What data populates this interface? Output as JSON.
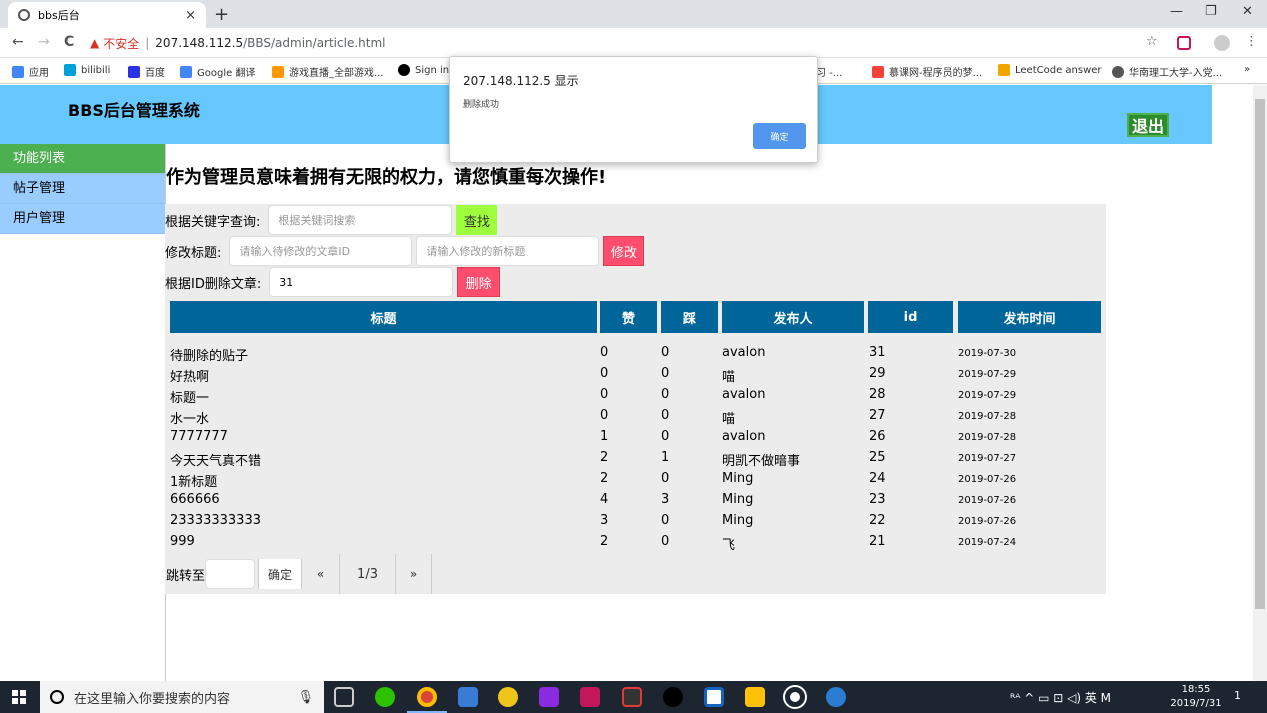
{
  "browser": {
    "tab_title": "bbs后台",
    "tab_close": "×",
    "new_tab": "+",
    "min": "—",
    "max": "❐",
    "close": "✕",
    "back": "←",
    "forward": "→",
    "reload": "C",
    "insecure_label": "不安全",
    "separator": "|",
    "url_host": "207.148.112.5",
    "url_path": "/BBS/admin/article.html",
    "star": "☆",
    "menu": "⋮",
    "bookmarks_more": "»",
    "bookmarks": [
      {
        "label": "应用",
        "icon": "apps-icon",
        "color": "#4285f4"
      },
      {
        "label": "bilibili",
        "icon": "bilibili-icon",
        "color": "#00a1d6"
      },
      {
        "label": "百度",
        "icon": "baidu-icon",
        "color": "#2932e1"
      },
      {
        "label": "Google 翻译",
        "icon": "google-translate-icon",
        "color": "#4285f4"
      },
      {
        "label": "游戏直播_全部游戏...",
        "icon": "game-icon",
        "color": "#ff9800"
      },
      {
        "label": "Sign in",
        "icon": "github-icon",
        "color": "#000000"
      },
      {
        "label": "学习 -...",
        "icon": "study-icon",
        "color": "#777777"
      },
      {
        "label": "慕课网-程序员的梦...",
        "icon": "imooc-icon",
        "color": "#f44336"
      },
      {
        "label": "LeetCode answer",
        "icon": "leetcode-icon",
        "color": "#f0a500"
      },
      {
        "label": "华南理工大学-入党...",
        "icon": "globe-icon",
        "color": "#555555"
      }
    ]
  },
  "dialog": {
    "title": "207.148.112.5 显示",
    "message": "删除成功",
    "ok": "确定"
  },
  "header": {
    "title": "BBS后台管理系统",
    "logout": "退出"
  },
  "sidebar": {
    "items": [
      {
        "label": "功能列表"
      },
      {
        "label": "帖子管理"
      },
      {
        "label": "用户管理"
      }
    ]
  },
  "main": {
    "warning_title": "作为管理员意味着拥有无限的权力，请您慎重每次操作!",
    "search_label": "根据关键字查询:",
    "search_placeholder": "根据关键词搜索",
    "search_button": "查找",
    "edit_label": "修改标题:",
    "edit_id_placeholder": "请输入待修改的文章ID",
    "edit_title_placeholder": "请输入修改的新标题",
    "edit_button": "修改",
    "delete_label": "根据ID删除文章:",
    "delete_value": "31",
    "delete_button": "删除"
  },
  "table": {
    "headers": [
      "标题",
      "赞",
      "踩",
      "发布人",
      "id",
      "发布时间"
    ],
    "rows": [
      [
        "待删除的贴子",
        "0",
        "0",
        "avalon",
        "31",
        "2019-07-30"
      ],
      [
        "好热啊",
        "0",
        "0",
        "喵",
        "29",
        "2019-07-29"
      ],
      [
        "标题一",
        "0",
        "0",
        "avalon",
        "28",
        "2019-07-29"
      ],
      [
        "水一水",
        "0",
        "0",
        "喵",
        "27",
        "2019-07-28"
      ],
      [
        "7777777",
        "1",
        "0",
        "avalon",
        "26",
        "2019-07-28"
      ],
      [
        "今天天气真不错",
        "2",
        "1",
        "明凯不做暗事",
        "25",
        "2019-07-27"
      ],
      [
        "1新标题",
        "2",
        "0",
        "Ming",
        "24",
        "2019-07-26"
      ],
      [
        "666666",
        "4",
        "3",
        "Ming",
        "23",
        "2019-07-26"
      ],
      [
        "23333333333",
        "3",
        "0",
        "Ming",
        "22",
        "2019-07-26"
      ],
      [
        "999",
        "2",
        "0",
        "飞",
        "21",
        "2019-07-24"
      ]
    ]
  },
  "pager": {
    "jump_label": "跳转至",
    "confirm": "确定",
    "prev": "«",
    "page": "1/3",
    "next": "»"
  },
  "taskbar": {
    "search_placeholder": "在这里输入你要搜索的内容",
    "tray_text": "ᴿᴬ  ^  ▭ ⊡ ◁) 英  M",
    "time": "18:55",
    "date": "2019/7/31",
    "notification_count": "1"
  }
}
